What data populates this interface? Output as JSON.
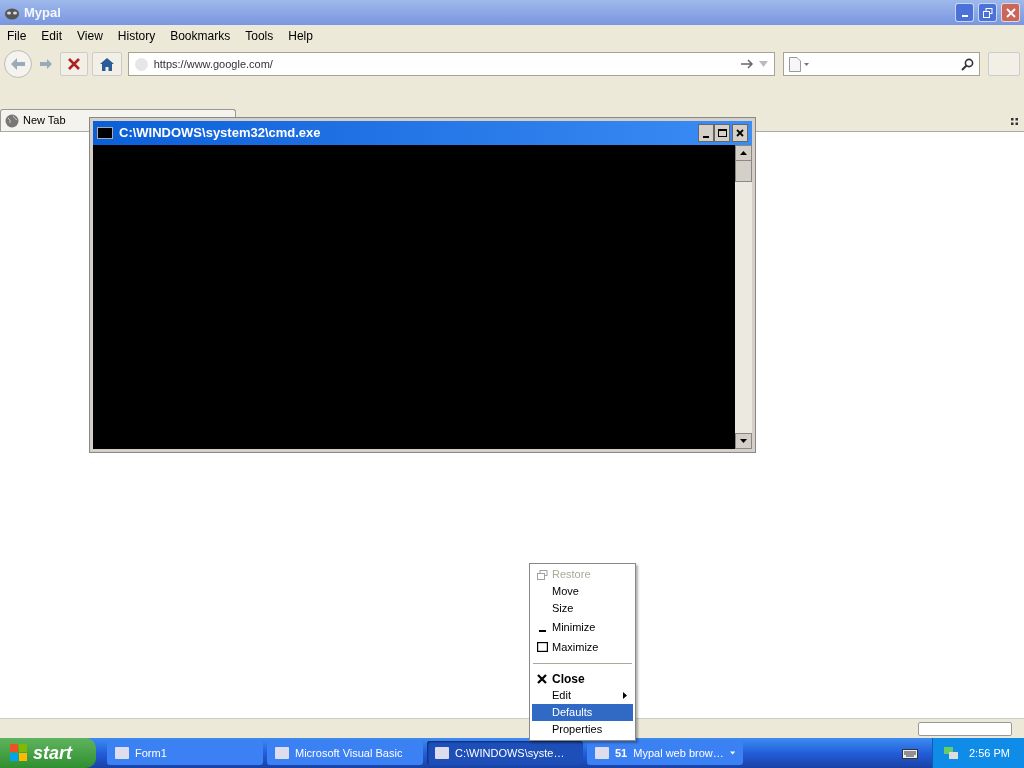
{
  "window": {
    "title": "Mypal"
  },
  "menu_bar": [
    "File",
    "Edit",
    "View",
    "History",
    "Bookmarks",
    "Tools",
    "Help"
  ],
  "address_bar": {
    "value": "https://www.google.com/"
  },
  "tabs": [
    {
      "label": "New Tab",
      "selected": true
    }
  ],
  "console_window": {
    "title": "C:\\WINDOWS\\system32\\cmd.exe"
  },
  "context_menu": [
    {
      "label": "Restore",
      "disabled": true,
      "default": false,
      "selected": false,
      "submenu": false,
      "separator_before": false
    },
    {
      "label": "Move",
      "disabled": false,
      "default": false,
      "selected": false,
      "submenu": false,
      "separator_before": false
    },
    {
      "label": "Size",
      "disabled": false,
      "default": false,
      "selected": false,
      "submenu": false,
      "separator_before": false
    },
    {
      "label": "Minimize",
      "disabled": false,
      "default": false,
      "selected": false,
      "submenu": false,
      "separator_before": false
    },
    {
      "label": "Maximize",
      "disabled": false,
      "default": false,
      "selected": false,
      "submenu": false,
      "separator_before": false
    },
    {
      "label": "Close",
      "disabled": false,
      "default": true,
      "selected": false,
      "submenu": false,
      "separator_before": true
    },
    {
      "label": "Edit",
      "disabled": false,
      "default": false,
      "selected": false,
      "submenu": true,
      "separator_before": false
    },
    {
      "label": "Defaults",
      "disabled": false,
      "default": false,
      "selected": true,
      "submenu": false,
      "separator_before": false
    },
    {
      "label": "Properties",
      "disabled": false,
      "default": false,
      "selected": false,
      "submenu": false,
      "separator_before": false
    }
  ],
  "taskbar": {
    "start": "start",
    "buttons": [
      {
        "label": "Form1",
        "selected": false
      },
      {
        "label": "Microsoft Visual Basic",
        "selected": false
      },
      {
        "label": "C:\\WINDOWS\\syste…",
        "selected": true
      },
      {
        "label": "Mypal web brow…",
        "count": "51",
        "selected": false
      }
    ],
    "clock": "2:56 PM"
  }
}
